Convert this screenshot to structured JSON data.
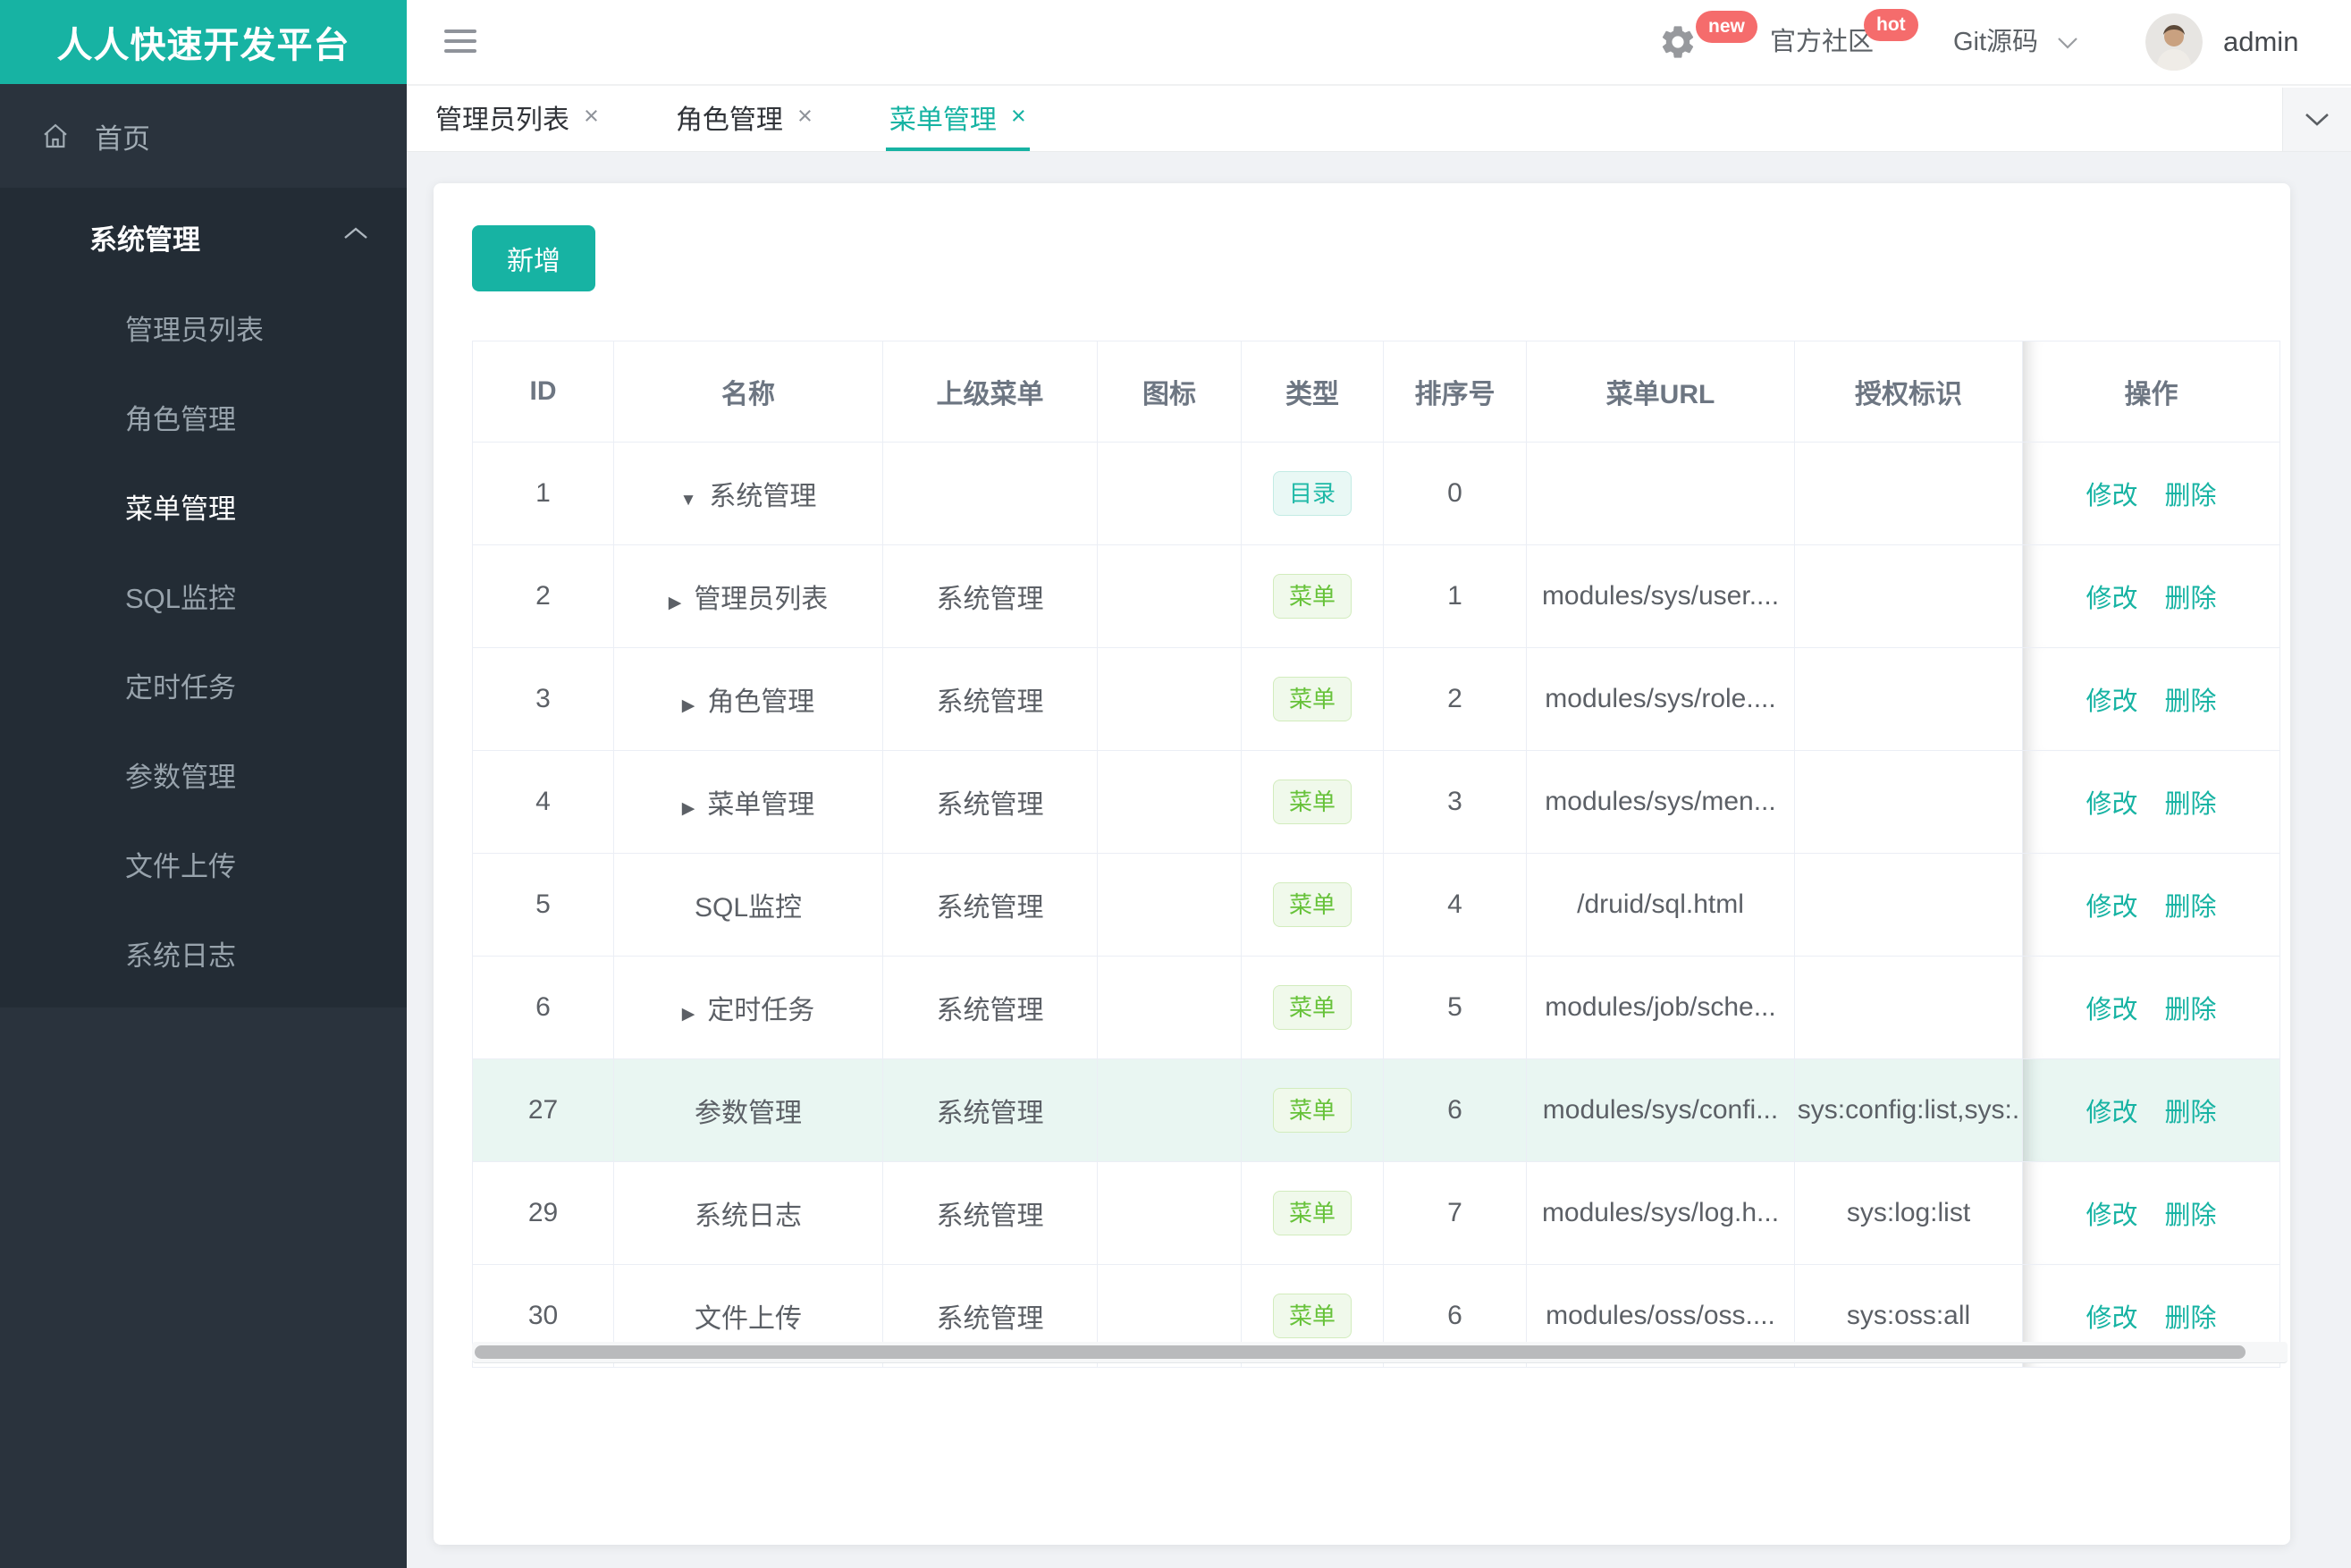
{
  "app_title": "人人快速开发平台",
  "colors": {
    "accent": "#17b3a3",
    "danger_badge": "#f56c6c",
    "menu_badge_green": "#67c23a",
    "dir_badge_teal": "#1fb9a7",
    "sidebar_bg": "#2a333d",
    "submenu_bg": "#232c35",
    "row_highlight": "#e9f6f2"
  },
  "topbar": {
    "settings_badge": "new",
    "community": "官方社区",
    "community_badge": "hot",
    "git": "Git源码",
    "username": "admin"
  },
  "sidebar": {
    "home": "首页",
    "group": "系统管理",
    "items": [
      "管理员列表",
      "角色管理",
      "菜单管理",
      "SQL监控",
      "定时任务",
      "参数管理",
      "文件上传",
      "系统日志"
    ],
    "active_item": "菜单管理"
  },
  "tabs": [
    {
      "label": "管理员列表",
      "active": false
    },
    {
      "label": "角色管理",
      "active": false
    },
    {
      "label": "菜单管理",
      "active": true
    }
  ],
  "toolbar": {
    "add": "新增"
  },
  "table": {
    "columns": [
      "ID",
      "名称",
      "上级菜单",
      "图标",
      "类型",
      "排序号",
      "菜单URL",
      "授权标识",
      "操作"
    ],
    "badge_labels": {
      "dir": "目录",
      "menu": "菜单"
    },
    "op_labels": {
      "edit": "修改",
      "delete": "删除"
    },
    "rows": [
      {
        "id": "1",
        "arrow": "expanded",
        "name": "系统管理",
        "parent": "",
        "type": "dir",
        "sort": "0",
        "url": "",
        "auth": "",
        "highlighted": false
      },
      {
        "id": "2",
        "arrow": "collapsed",
        "name": "管理员列表",
        "parent": "系统管理",
        "type": "menu",
        "sort": "1",
        "url": "modules/sys/user....",
        "auth": "",
        "highlighted": false
      },
      {
        "id": "3",
        "arrow": "collapsed",
        "name": "角色管理",
        "parent": "系统管理",
        "type": "menu",
        "sort": "2",
        "url": "modules/sys/role....",
        "auth": "",
        "highlighted": false
      },
      {
        "id": "4",
        "arrow": "collapsed",
        "name": "菜单管理",
        "parent": "系统管理",
        "type": "menu",
        "sort": "3",
        "url": "modules/sys/men...",
        "auth": "",
        "highlighted": false
      },
      {
        "id": "5",
        "arrow": "none",
        "name": "SQL监控",
        "parent": "系统管理",
        "type": "menu",
        "sort": "4",
        "url": "/druid/sql.html",
        "auth": "",
        "highlighted": false
      },
      {
        "id": "6",
        "arrow": "collapsed",
        "name": "定时任务",
        "parent": "系统管理",
        "type": "menu",
        "sort": "5",
        "url": "modules/job/sche...",
        "auth": "",
        "highlighted": false
      },
      {
        "id": "27",
        "arrow": "none",
        "name": "参数管理",
        "parent": "系统管理",
        "type": "menu",
        "sort": "6",
        "url": "modules/sys/confi...",
        "auth": "sys:config:list,sys:.",
        "highlighted": true
      },
      {
        "id": "29",
        "arrow": "none",
        "name": "系统日志",
        "parent": "系统管理",
        "type": "menu",
        "sort": "7",
        "url": "modules/sys/log.h...",
        "auth": "sys:log:list",
        "highlighted": false
      },
      {
        "id": "30",
        "arrow": "none",
        "name": "文件上传",
        "parent": "系统管理",
        "type": "menu",
        "sort": "6",
        "url": "modules/oss/oss....",
        "auth": "sys:oss:all",
        "highlighted": false
      }
    ]
  }
}
